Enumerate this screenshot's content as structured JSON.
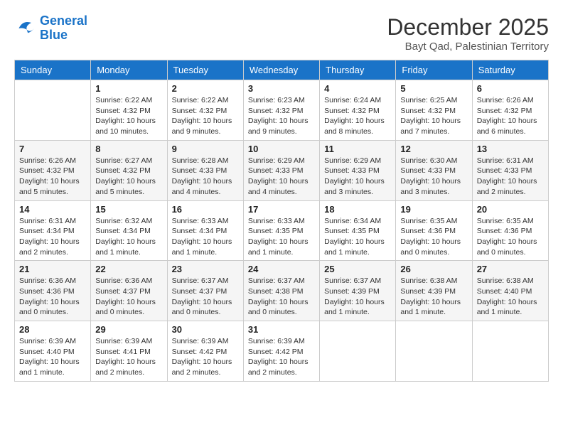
{
  "logo": {
    "line1": "General",
    "line2": "Blue"
  },
  "title": "December 2025",
  "subtitle": "Bayt Qad, Palestinian Territory",
  "weekdays": [
    "Sunday",
    "Monday",
    "Tuesday",
    "Wednesday",
    "Thursday",
    "Friday",
    "Saturday"
  ],
  "weeks": [
    [
      {
        "day": null,
        "info": null
      },
      {
        "day": "1",
        "info": "Sunrise: 6:22 AM\nSunset: 4:32 PM\nDaylight: 10 hours\nand 10 minutes."
      },
      {
        "day": "2",
        "info": "Sunrise: 6:22 AM\nSunset: 4:32 PM\nDaylight: 10 hours\nand 9 minutes."
      },
      {
        "day": "3",
        "info": "Sunrise: 6:23 AM\nSunset: 4:32 PM\nDaylight: 10 hours\nand 9 minutes."
      },
      {
        "day": "4",
        "info": "Sunrise: 6:24 AM\nSunset: 4:32 PM\nDaylight: 10 hours\nand 8 minutes."
      },
      {
        "day": "5",
        "info": "Sunrise: 6:25 AM\nSunset: 4:32 PM\nDaylight: 10 hours\nand 7 minutes."
      },
      {
        "day": "6",
        "info": "Sunrise: 6:26 AM\nSunset: 4:32 PM\nDaylight: 10 hours\nand 6 minutes."
      }
    ],
    [
      {
        "day": "7",
        "info": "Sunrise: 6:26 AM\nSunset: 4:32 PM\nDaylight: 10 hours\nand 5 minutes."
      },
      {
        "day": "8",
        "info": "Sunrise: 6:27 AM\nSunset: 4:32 PM\nDaylight: 10 hours\nand 5 minutes."
      },
      {
        "day": "9",
        "info": "Sunrise: 6:28 AM\nSunset: 4:33 PM\nDaylight: 10 hours\nand 4 minutes."
      },
      {
        "day": "10",
        "info": "Sunrise: 6:29 AM\nSunset: 4:33 PM\nDaylight: 10 hours\nand 4 minutes."
      },
      {
        "day": "11",
        "info": "Sunrise: 6:29 AM\nSunset: 4:33 PM\nDaylight: 10 hours\nand 3 minutes."
      },
      {
        "day": "12",
        "info": "Sunrise: 6:30 AM\nSunset: 4:33 PM\nDaylight: 10 hours\nand 3 minutes."
      },
      {
        "day": "13",
        "info": "Sunrise: 6:31 AM\nSunset: 4:33 PM\nDaylight: 10 hours\nand 2 minutes."
      }
    ],
    [
      {
        "day": "14",
        "info": "Sunrise: 6:31 AM\nSunset: 4:34 PM\nDaylight: 10 hours\nand 2 minutes."
      },
      {
        "day": "15",
        "info": "Sunrise: 6:32 AM\nSunset: 4:34 PM\nDaylight: 10 hours\nand 1 minute."
      },
      {
        "day": "16",
        "info": "Sunrise: 6:33 AM\nSunset: 4:34 PM\nDaylight: 10 hours\nand 1 minute."
      },
      {
        "day": "17",
        "info": "Sunrise: 6:33 AM\nSunset: 4:35 PM\nDaylight: 10 hours\nand 1 minute."
      },
      {
        "day": "18",
        "info": "Sunrise: 6:34 AM\nSunset: 4:35 PM\nDaylight: 10 hours\nand 1 minute."
      },
      {
        "day": "19",
        "info": "Sunrise: 6:35 AM\nSunset: 4:36 PM\nDaylight: 10 hours\nand 0 minutes."
      },
      {
        "day": "20",
        "info": "Sunrise: 6:35 AM\nSunset: 4:36 PM\nDaylight: 10 hours\nand 0 minutes."
      }
    ],
    [
      {
        "day": "21",
        "info": "Sunrise: 6:36 AM\nSunset: 4:36 PM\nDaylight: 10 hours\nand 0 minutes."
      },
      {
        "day": "22",
        "info": "Sunrise: 6:36 AM\nSunset: 4:37 PM\nDaylight: 10 hours\nand 0 minutes."
      },
      {
        "day": "23",
        "info": "Sunrise: 6:37 AM\nSunset: 4:37 PM\nDaylight: 10 hours\nand 0 minutes."
      },
      {
        "day": "24",
        "info": "Sunrise: 6:37 AM\nSunset: 4:38 PM\nDaylight: 10 hours\nand 0 minutes."
      },
      {
        "day": "25",
        "info": "Sunrise: 6:37 AM\nSunset: 4:39 PM\nDaylight: 10 hours\nand 1 minute."
      },
      {
        "day": "26",
        "info": "Sunrise: 6:38 AM\nSunset: 4:39 PM\nDaylight: 10 hours\nand 1 minute."
      },
      {
        "day": "27",
        "info": "Sunrise: 6:38 AM\nSunset: 4:40 PM\nDaylight: 10 hours\nand 1 minute."
      }
    ],
    [
      {
        "day": "28",
        "info": "Sunrise: 6:39 AM\nSunset: 4:40 PM\nDaylight: 10 hours\nand 1 minute."
      },
      {
        "day": "29",
        "info": "Sunrise: 6:39 AM\nSunset: 4:41 PM\nDaylight: 10 hours\nand 2 minutes."
      },
      {
        "day": "30",
        "info": "Sunrise: 6:39 AM\nSunset: 4:42 PM\nDaylight: 10 hours\nand 2 minutes."
      },
      {
        "day": "31",
        "info": "Sunrise: 6:39 AM\nSunset: 4:42 PM\nDaylight: 10 hours\nand 2 minutes."
      },
      {
        "day": null,
        "info": null
      },
      {
        "day": null,
        "info": null
      },
      {
        "day": null,
        "info": null
      }
    ]
  ]
}
